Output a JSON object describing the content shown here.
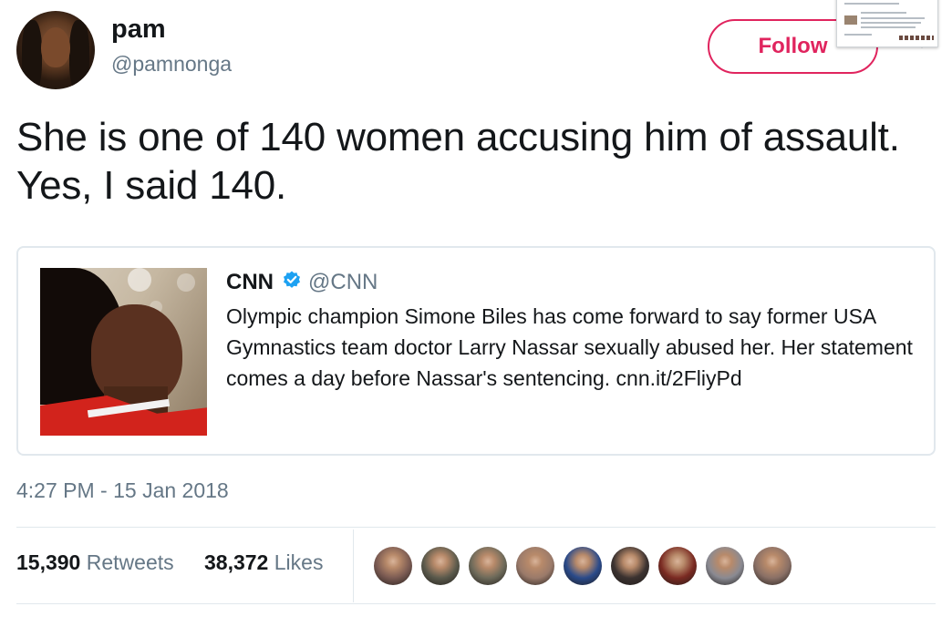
{
  "author": {
    "name": "pam",
    "handle": "@pamnonga",
    "avatar_icon": "user-avatar"
  },
  "follow_button": {
    "label": "Follow",
    "color": "#e0245e"
  },
  "tweet": {
    "text": "She is one of 140 women accusing him of assault. Yes, I said 140.",
    "timestamp": "4:27 PM - 15 Jan 2018"
  },
  "quoted_tweet": {
    "name": "CNN",
    "verified": true,
    "handle": "@CNN",
    "text": "Olympic champion Simone Biles has come forward to say former USA Gymnastics team doctor Larry Nassar sexually abused her. Her statement comes a day before Nassar's sentencing. cnn.it/2FliyPd"
  },
  "stats": {
    "retweets_count": "15,390",
    "retweets_label": "Retweets",
    "likes_count": "38,372",
    "likes_label": "Likes"
  },
  "likers": [
    {
      "icon": "liker-avatar",
      "color": "#7a5a52"
    },
    {
      "icon": "liker-avatar",
      "color": "#5b5a4c"
    },
    {
      "icon": "liker-avatar",
      "color": "#6d6a5a"
    },
    {
      "icon": "liker-avatar",
      "color": "#9a7a6a"
    },
    {
      "icon": "liker-avatar",
      "color": "#2a4a8a"
    },
    {
      "icon": "liker-avatar",
      "color": "#3b3230"
    },
    {
      "icon": "liker-avatar",
      "color": "#7a2a22"
    },
    {
      "icon": "liker-avatar",
      "color": "#8a8a92"
    },
    {
      "icon": "liker-avatar",
      "color": "#8a7066"
    }
  ],
  "colors": {
    "text": "#14171a",
    "secondary_text": "#657786",
    "border": "#e1e8ed",
    "verified_blue": "#1da1f2"
  }
}
